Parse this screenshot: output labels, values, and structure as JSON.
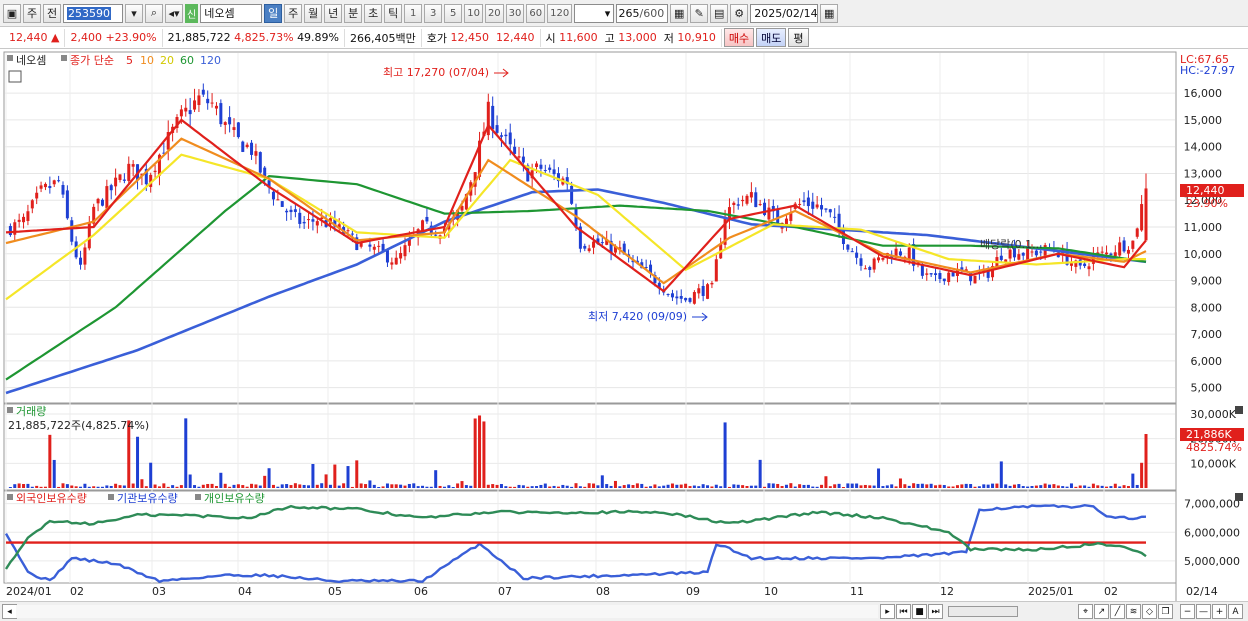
{
  "toolbar": {
    "period": "주",
    "prev_btn": "전",
    "code": "253590",
    "badge": "신",
    "stock_name": "네오셈",
    "intervals": [
      "일",
      "주",
      "월",
      "년",
      "분",
      "초",
      "틱"
    ],
    "active_interval": "일",
    "numbers": [
      "1",
      "3",
      "5",
      "10",
      "20",
      "30",
      "60",
      "120"
    ],
    "count": "265",
    "count_total": "/600",
    "date": "2025/02/14"
  },
  "info": {
    "price": "12,440",
    "arrow": "▲",
    "change": "2,400",
    "change_pct": "+23.90%",
    "volume": "21,885,722",
    "volume_pct": "4,825.73%",
    "ratio": "49.89%",
    "amount": "266,405백만",
    "quote_label": "호가",
    "quote1": "12,450",
    "quote2": "12,440",
    "open_label": "시",
    "open": "11,600",
    "high_label": "고",
    "high": "13,000",
    "low_label": "저",
    "low": "10,910",
    "buy": "매수",
    "sell": "매도",
    "eval": "평"
  },
  "price_panel": {
    "legend_name": "네오셈",
    "legend_ma": "종가 단순",
    "legend_periods": [
      "5",
      "10",
      "20",
      "60",
      "120"
    ],
    "lc": "LC:67.65",
    "hc": "HC:-27.97",
    "max_label": "최고 17,270 (07/04)",
    "min_label": "최저 7,420 (09/09)",
    "div_label": "배당락(0.1...",
    "current_price": "12,440",
    "current_pct": "23.90%",
    "y_ticks": [
      "16,000",
      "15,000",
      "14,000",
      "13,000",
      "12,000",
      "11,000",
      "10,000",
      "9,000",
      "8,000",
      "7,000",
      "6,000",
      "5,000"
    ]
  },
  "volume_panel": {
    "title": "거래량",
    "value": "21,885,722주(4,825.74%)",
    "tag_value": "21,886K",
    "tag_pct": "4825.74%",
    "y_ticks": [
      "30,000K",
      "20,000K",
      "10,000K"
    ]
  },
  "holder_panel": {
    "legend": [
      "외국인보유수량",
      "기관보유수량",
      "개인보유수량"
    ],
    "y_ticks": [
      "7,000,000",
      "6,000,000",
      "5,000,000"
    ]
  },
  "x_axis": [
    "2024/01",
    "02",
    "03",
    "04",
    "05",
    "06",
    "07",
    "08",
    "09",
    "10",
    "11",
    "12",
    "2025/01",
    "02"
  ],
  "x_axis_end": "02/14",
  "colors": {
    "up": "#e0201c",
    "down": "#1e3fd3",
    "ma5": "#e0201c",
    "ma10": "#f08c1e",
    "ma20": "#f5e628",
    "ma60": "#1e9632",
    "ma120": "#3a5fd8",
    "holder_green": "#2e8b57",
    "holder_red": "#e0201c"
  },
  "chart_data": {
    "type": "candlestick",
    "title": "네오셈",
    "ylim": [
      4500,
      17500
    ],
    "highest": {
      "value": 17270,
      "date": "07/04"
    },
    "lowest": {
      "value": 7420,
      "date": "09/09"
    },
    "last_close": 12440,
    "close_path_points": [
      [
        0,
        10900
      ],
      [
        4,
        11200
      ],
      [
        8,
        12300
      ],
      [
        12,
        12700
      ],
      [
        15,
        10500
      ],
      [
        17,
        9400
      ],
      [
        20,
        11700
      ],
      [
        24,
        12400
      ],
      [
        28,
        13200
      ],
      [
        32,
        12800
      ],
      [
        36,
        14000
      ],
      [
        40,
        15100
      ],
      [
        44,
        15800
      ],
      [
        47,
        15600
      ],
      [
        50,
        14800
      ],
      [
        53,
        14200
      ],
      [
        56,
        13900
      ],
      [
        59,
        12700
      ],
      [
        62,
        12000
      ],
      [
        65,
        11400
      ],
      [
        68,
        11100
      ],
      [
        71,
        11300
      ],
      [
        74,
        11100
      ],
      [
        77,
        10800
      ],
      [
        80,
        10400
      ],
      [
        83,
        10200
      ],
      [
        86,
        10000
      ],
      [
        89,
        9700
      ],
      [
        92,
        10400
      ],
      [
        95,
        11000
      ],
      [
        98,
        10900
      ],
      [
        101,
        11000
      ],
      [
        104,
        11700
      ],
      [
        107,
        13300
      ],
      [
        110,
        15300
      ],
      [
        113,
        14400
      ],
      [
        116,
        13600
      ],
      [
        119,
        13000
      ],
      [
        122,
        13200
      ],
      [
        125,
        12900
      ],
      [
        128,
        12700
      ],
      [
        131,
        10400
      ],
      [
        134,
        10400
      ],
      [
        137,
        10300
      ],
      [
        140,
        10100
      ],
      [
        143,
        9600
      ],
      [
        146,
        9300
      ],
      [
        149,
        8900
      ],
      [
        152,
        8400
      ],
      [
        155,
        8300
      ],
      [
        158,
        8600
      ],
      [
        161,
        8700
      ],
      [
        164,
        11500
      ],
      [
        167,
        12000
      ],
      [
        170,
        12100
      ],
      [
        173,
        11700
      ],
      [
        176,
        11200
      ],
      [
        179,
        11700
      ],
      [
        182,
        11900
      ],
      [
        185,
        11800
      ],
      [
        188,
        11400
      ],
      [
        191,
        10600
      ],
      [
        194,
        9900
      ],
      [
        197,
        9500
      ],
      [
        200,
        9900
      ],
      [
        203,
        10100
      ],
      [
        206,
        10000
      ],
      [
        209,
        9200
      ],
      [
        212,
        9000
      ],
      [
        215,
        9300
      ],
      [
        218,
        9300
      ],
      [
        221,
        9100
      ],
      [
        224,
        9300
      ],
      [
        227,
        10000
      ],
      [
        230,
        10100
      ],
      [
        233,
        10000
      ],
      [
        236,
        10100
      ],
      [
        239,
        10200
      ],
      [
        242,
        9800
      ],
      [
        245,
        9400
      ],
      [
        248,
        9900
      ],
      [
        251,
        10000
      ],
      [
        254,
        10300
      ],
      [
        257,
        10440
      ],
      [
        260,
        12440
      ]
    ],
    "ma_series": [
      {
        "name": "5",
        "values": [
          [
            0,
            10800
          ],
          [
            20,
            11000
          ],
          [
            40,
            15000
          ],
          [
            60,
            12500
          ],
          [
            80,
            10400
          ],
          [
            100,
            11000
          ],
          [
            110,
            14800
          ],
          [
            130,
            11000
          ],
          [
            150,
            8600
          ],
          [
            165,
            11300
          ],
          [
            180,
            11800
          ],
          [
            200,
            9900
          ],
          [
            220,
            9200
          ],
          [
            240,
            10000
          ],
          [
            255,
            9500
          ],
          [
            260,
            10500
          ]
        ]
      },
      {
        "name": "10",
        "values": [
          [
            0,
            10400
          ],
          [
            20,
            11200
          ],
          [
            40,
            14300
          ],
          [
            60,
            12800
          ],
          [
            80,
            10500
          ],
          [
            100,
            10800
          ],
          [
            110,
            13500
          ],
          [
            130,
            11400
          ],
          [
            150,
            8900
          ],
          [
            165,
            10600
          ],
          [
            180,
            11600
          ],
          [
            200,
            10000
          ],
          [
            220,
            9300
          ],
          [
            240,
            10000
          ],
          [
            255,
            9700
          ],
          [
            260,
            10100
          ]
        ]
      },
      {
        "name": "20",
        "values": [
          [
            0,
            8300
          ],
          [
            20,
            10700
          ],
          [
            40,
            13700
          ],
          [
            60,
            12800
          ],
          [
            80,
            10800
          ],
          [
            100,
            10600
          ],
          [
            115,
            13500
          ],
          [
            135,
            12200
          ],
          [
            155,
            9400
          ],
          [
            175,
            11100
          ],
          [
            195,
            10900
          ],
          [
            215,
            9800
          ],
          [
            235,
            9600
          ],
          [
            255,
            9800
          ],
          [
            260,
            9800
          ]
        ]
      },
      {
        "name": "60",
        "values": [
          [
            0,
            5300
          ],
          [
            25,
            8000
          ],
          [
            50,
            11600
          ],
          [
            60,
            12900
          ],
          [
            80,
            12600
          ],
          [
            100,
            11500
          ],
          [
            120,
            11600
          ],
          [
            140,
            11800
          ],
          [
            160,
            11600
          ],
          [
            180,
            11000
          ],
          [
            200,
            10300
          ],
          [
            220,
            10300
          ],
          [
            240,
            10200
          ],
          [
            260,
            9700
          ]
        ]
      },
      {
        "name": "120",
        "values": [
          [
            0,
            4800
          ],
          [
            30,
            6400
          ],
          [
            60,
            8400
          ],
          [
            80,
            9600
          ],
          [
            100,
            11200
          ],
          [
            120,
            12300
          ],
          [
            135,
            12400
          ],
          [
            150,
            11900
          ],
          [
            170,
            11100
          ],
          [
            190,
            10900
          ],
          [
            210,
            10700
          ],
          [
            230,
            10300
          ],
          [
            250,
            9900
          ],
          [
            260,
            9700
          ]
        ]
      }
    ],
    "volume_max_k": 30000,
    "last_volume_k": 21886,
    "holder_ylim": [
      4300000,
      7300000
    ],
    "holders": [
      {
        "name": "외국인보유수량",
        "values": [
          [
            0,
            6000000
          ],
          [
            5,
            4600000
          ],
          [
            10,
            4300000
          ],
          [
            15,
            5100000
          ],
          [
            25,
            4900000
          ],
          [
            35,
            4300000
          ],
          [
            50,
            4500000
          ],
          [
            60,
            4500000
          ],
          [
            75,
            4300000
          ],
          [
            95,
            4300000
          ],
          [
            108,
            5600000
          ],
          [
            118,
            4400000
          ],
          [
            140,
            4500000
          ],
          [
            160,
            4600000
          ],
          [
            162,
            5600000
          ],
          [
            170,
            5100000
          ],
          [
            200,
            5100000
          ],
          [
            219,
            5300000
          ],
          [
            222,
            6800000
          ],
          [
            235,
            6900000
          ],
          [
            248,
            6900000
          ],
          [
            252,
            6500000
          ],
          [
            260,
            6500000
          ]
        ]
      },
      {
        "name": "기관보유수량",
        "values": [
          [
            0,
            5640000
          ],
          [
            260,
            5640000
          ]
        ]
      },
      {
        "name": "개인보유수량",
        "values": [
          [
            0,
            4700000
          ],
          [
            5,
            5800000
          ],
          [
            10,
            6400000
          ],
          [
            20,
            6300000
          ],
          [
            30,
            6600000
          ],
          [
            40,
            6600000
          ],
          [
            55,
            6500000
          ],
          [
            65,
            6900000
          ],
          [
            80,
            6800000
          ],
          [
            95,
            6500000
          ],
          [
            110,
            6700000
          ],
          [
            130,
            6700000
          ],
          [
            150,
            6700000
          ],
          [
            165,
            6300000
          ],
          [
            185,
            6700000
          ],
          [
            200,
            6500000
          ],
          [
            215,
            6000000
          ],
          [
            220,
            5400000
          ],
          [
            235,
            5400000
          ],
          [
            250,
            5600000
          ],
          [
            255,
            5500000
          ],
          [
            260,
            5200000
          ]
        ]
      }
    ]
  }
}
